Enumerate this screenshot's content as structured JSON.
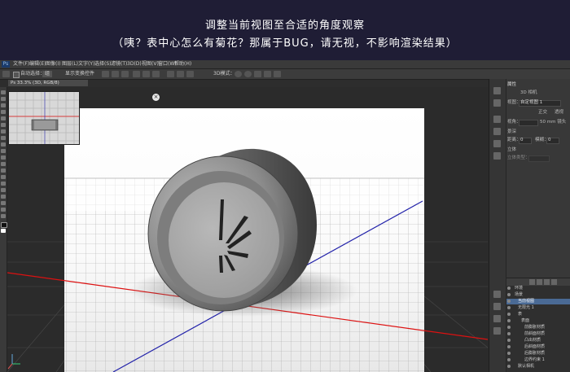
{
  "caption": {
    "line1": "调整当前视图至合适的角度观察",
    "line2": "（咦？表中心怎么有菊花？那属于BUG，请无视，不影响渲染结果）"
  },
  "menu": [
    "文件(F)",
    "编辑(E)",
    "图像(I)",
    "图层(L)",
    "文字(Y)",
    "选择(S)",
    "滤镜(T)",
    "3D(D)",
    "视图(V)",
    "窗口(W)",
    "帮助(H)"
  ],
  "options": {
    "auto_select_label": "自动选择：",
    "auto_select_value": "组",
    "transform_label": "显示变换控件",
    "mode_3d_label": "3D模式："
  },
  "document_tab": "Ps 33.3% (3D, RGB/8)",
  "properties": {
    "header": "属性",
    "camera_label": "3D 相机",
    "view_label": "视图：",
    "view_value": "自定视图 1",
    "ortho_label": "正交",
    "perspective_label": "透视",
    "fov_label": "视角：",
    "fov_value": "50 mm 镜头",
    "depth_label": "景深",
    "distance_label": "距离：",
    "distance_value": "0",
    "blur_label": "模糊：",
    "blur_value": "0",
    "stereo_label": "立体",
    "stereo_type_label": "立体类型："
  },
  "layers": [
    {
      "name": "环境",
      "selected": false
    },
    {
      "name": "场景",
      "selected": false
    },
    {
      "name": "当前视图",
      "selected": true
    },
    {
      "name": "无限光 1",
      "selected": false
    },
    {
      "name": "表",
      "selected": false
    },
    {
      "name": "表面",
      "selected": false
    },
    {
      "name": "前膨胀材质",
      "selected": false
    },
    {
      "name": "前斜面材质",
      "selected": false
    },
    {
      "name": "凸出材质",
      "selected": false
    },
    {
      "name": "后斜面材质",
      "selected": false
    },
    {
      "name": "后膨胀材质",
      "selected": false
    },
    {
      "name": "边界约束 1",
      "selected": false
    },
    {
      "name": "默认相机",
      "selected": false
    }
  ]
}
